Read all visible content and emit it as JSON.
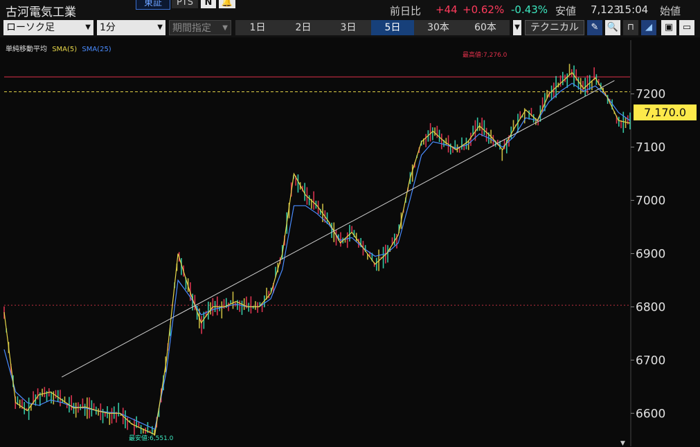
{
  "header": {
    "stock_name": "古河電気工業",
    "market_tab": "東証",
    "pts_tab": "PTS",
    "news_icon_glyph": "N",
    "alert_icon_glyph": "🔔",
    "change_label": "前日比",
    "change_value": "+44",
    "change_pct": "+0.62%",
    "low_pct": "-0.43%",
    "low_label": "安値",
    "last_price": "7,123",
    "time": "15:04",
    "open_label": "始値",
    "colors": {
      "up": "#ff3b5c",
      "down": "#3ce8c0"
    }
  },
  "toolbar": {
    "chart_type": "ローソク足",
    "interval": "1分",
    "period_placeholder": "期間指定",
    "range_tabs": [
      "1日",
      "2日",
      "3日",
      "5日",
      "30本",
      "60本"
    ],
    "active_range": "5日",
    "technical_label": "テクニカル",
    "tool_icons": [
      "pen-icon",
      "zoom-icon",
      "bracket-icon",
      "area-chart-icon",
      "save-icon",
      "folder-icon"
    ]
  },
  "chart": {
    "indicator_label": "単純移動平均",
    "sma_short": "SMA(5)",
    "sma_long": "SMA(25)",
    "sma_short_color": "#e8d84a",
    "sma_long_color": "#4a8cff",
    "current_price": "7,170.0",
    "high_label": "最高値:7,276.0",
    "low_label": "最安値:6,551.0",
    "colors": {
      "high_line": "#e0304a",
      "low_line": "#c03040",
      "prev_line": "#e8d84a",
      "trend_line": "#cfcfcf"
    }
  },
  "chart_data": {
    "type": "line",
    "y_ticks": [
      "7200",
      "7100",
      "7000",
      "6900",
      "6800",
      "6700",
      "6600"
    ],
    "ylim": [
      6538,
      7301
    ],
    "reference_lines": {
      "high": 7232,
      "prev_close": 7204,
      "low": 6803
    },
    "high": 7276.0,
    "low": 6551.0,
    "trend_line": {
      "from": [
        0.092,
        6668
      ],
      "to": [
        0.975,
        7225
      ]
    },
    "series": [
      {
        "name": "SMA(5)",
        "values": [
          6790,
          6620,
          6605,
          6635,
          6640,
          6625,
          6610,
          6612,
          6605,
          6600,
          6600,
          6580,
          6570,
          6560,
          6700,
          6900,
          6830,
          6770,
          6800,
          6800,
          6810,
          6800,
          6800,
          6825,
          6900,
          7050,
          7010,
          6990,
          6960,
          6920,
          6940,
          6910,
          6880,
          6900,
          6935,
          7040,
          7110,
          7130,
          7110,
          7095,
          7110,
          7140,
          7120,
          7095,
          7135,
          7170,
          7150,
          7200,
          7220,
          7240,
          7210,
          7230,
          7195,
          7150,
          7145
        ]
      },
      {
        "name": "SMA(25)",
        "values": [
          6720,
          6640,
          6620,
          6615,
          6625,
          6620,
          6612,
          6610,
          6605,
          6602,
          6600,
          6590,
          6580,
          6570,
          6680,
          6850,
          6820,
          6785,
          6795,
          6800,
          6805,
          6800,
          6800,
          6815,
          6870,
          6990,
          6990,
          6975,
          6955,
          6925,
          6930,
          6910,
          6895,
          6900,
          6920,
          7000,
          7085,
          7110,
          7105,
          7098,
          7105,
          7125,
          7115,
          7100,
          7120,
          7155,
          7150,
          7185,
          7205,
          7220,
          7205,
          7215,
          7195,
          7165,
          7150
        ]
      }
    ]
  },
  "tooltip": {}
}
